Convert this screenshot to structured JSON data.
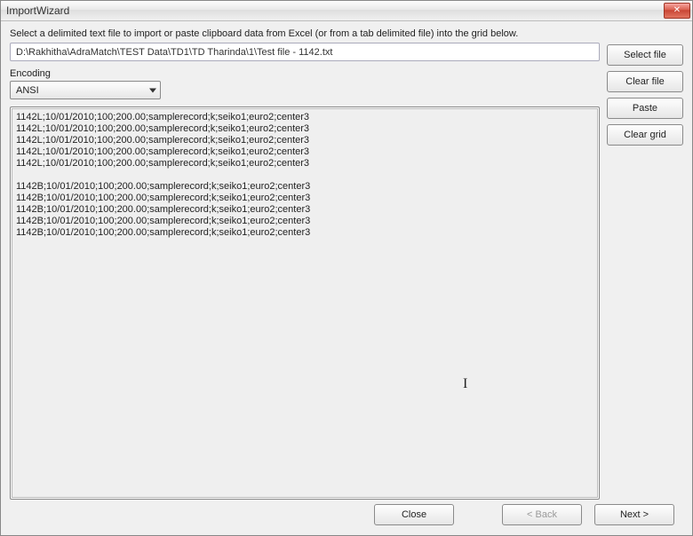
{
  "window": {
    "title": "ImportWizard"
  },
  "instructions": "Select a delimited text file to import or paste clipboard data from Excel (or from a tab delimited file) into the grid below.",
  "filepath": "D:\\Rakhitha\\AdraMatch\\TEST Data\\TD1\\TD Tharinda\\1\\Test file - 1142.txt",
  "encoding": {
    "label": "Encoding",
    "value": "ANSI"
  },
  "buttons": {
    "select_file": "Select file",
    "clear_file": "Clear file",
    "paste": "Paste",
    "clear_grid": "Clear grid",
    "close": "Close",
    "back": "< Back",
    "next": "Next >"
  },
  "data_lines": [
    "1142L;10/01/2010;100;200.00;samplerecord;k;seiko1;euro2;center3",
    "1142L;10/01/2010;100;200.00;samplerecord;k;seiko1;euro2;center3",
    "1142L;10/01/2010;100;200.00;samplerecord;k;seiko1;euro2;center3",
    "1142L;10/01/2010;100;200.00;samplerecord;k;seiko1;euro2;center3",
    "1142L;10/01/2010;100;200.00;samplerecord;k;seiko1;euro2;center3",
    "",
    "1142B;10/01/2010;100;200.00;samplerecord;k;seiko1;euro2;center3",
    "1142B;10/01/2010;100;200.00;samplerecord;k;seiko1;euro2;center3",
    "1142B;10/01/2010;100;200.00;samplerecord;k;seiko1;euro2;center3",
    "1142B;10/01/2010;100;200.00;samplerecord;k;seiko1;euro2;center3",
    "1142B;10/01/2010;100;200.00;samplerecord;k;seiko1;euro2;center3"
  ]
}
